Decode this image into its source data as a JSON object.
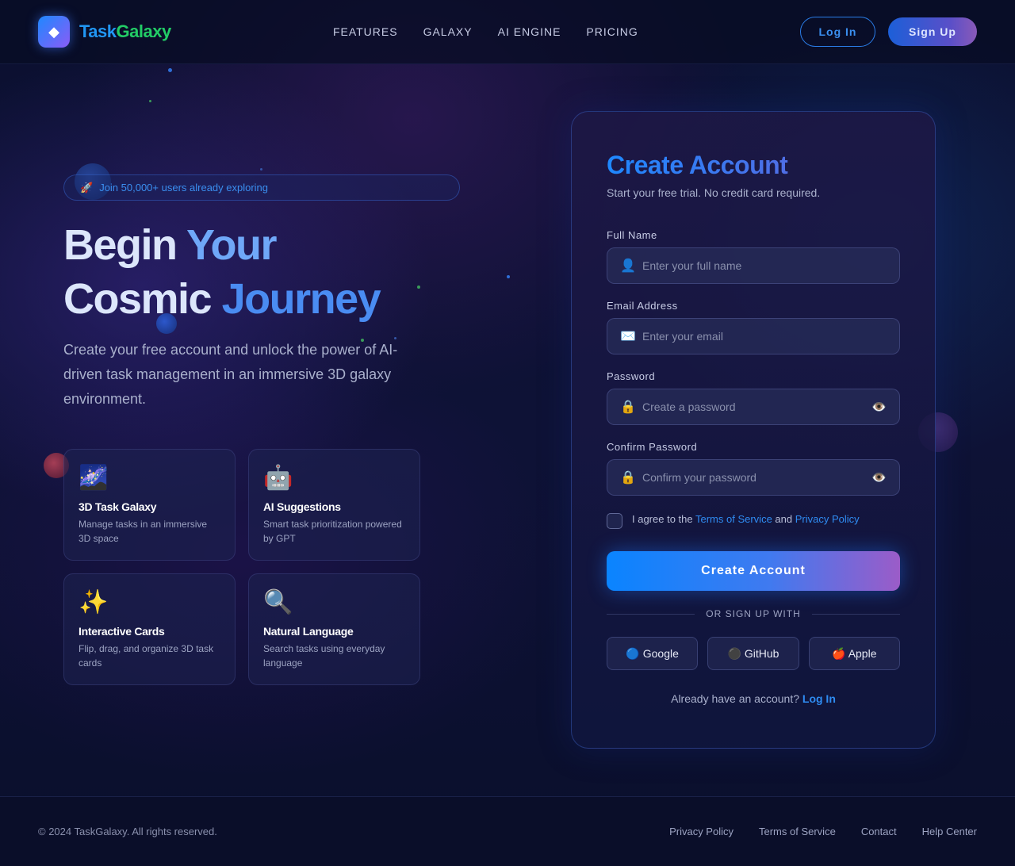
{
  "header": {
    "logo_glyph": "◆",
    "brand_part1": "Task",
    "brand_part2": "Galaxy",
    "nav": [
      "FEATURES",
      "GALAXY",
      "AI ENGINE",
      "PRICING"
    ],
    "login_label": "Log In",
    "signup_label": "Sign Up"
  },
  "hero": {
    "badge_icon": "🚀",
    "badge_text": "Join 50,000+ users already exploring",
    "title_line1_a": "Begin ",
    "title_line1_b": "Your",
    "title_line2_a": "Cosmic ",
    "title_line2_b": "Journey",
    "subtitle": "Create your free account and unlock the power of AI-driven task management in an immersive 3D galaxy environment."
  },
  "features": [
    {
      "icon": "🌌",
      "title": "3D Task Galaxy",
      "desc": "Manage tasks in an immersive 3D space"
    },
    {
      "icon": "🤖",
      "title": "AI Suggestions",
      "desc": "Smart task prioritization powered by GPT"
    },
    {
      "icon": "✨",
      "title": "Interactive Cards",
      "desc": "Flip, drag, and organize 3D task cards"
    },
    {
      "icon": "🔍",
      "title": "Natural Language",
      "desc": "Search tasks using everyday language"
    }
  ],
  "form": {
    "title": "Create Account",
    "subtitle": "Start your free trial. No credit card required.",
    "fields": {
      "full_name": {
        "label": "Full Name",
        "placeholder": "Enter your full name",
        "icon": "👤"
      },
      "email": {
        "label": "Email Address",
        "placeholder": "Enter your email",
        "icon": "✉️"
      },
      "password": {
        "label": "Password",
        "placeholder": "Create a password",
        "icon": "🔒",
        "toggle": "👁️"
      },
      "confirm": {
        "label": "Confirm Password",
        "placeholder": "Confirm your password",
        "icon": "🔒",
        "toggle": "👁️"
      }
    },
    "agree_prefix": "I agree to the ",
    "terms_link": "Terms of Service",
    "agree_mid": " and ",
    "privacy_link": "Privacy Policy",
    "submit_label": "Create Account",
    "divider_text": "OR SIGN UP WITH",
    "social": [
      {
        "icon": "🔵",
        "label": "Google"
      },
      {
        "icon": "⚫",
        "label": "GitHub"
      },
      {
        "icon": "🍎",
        "label": "Apple"
      }
    ],
    "login_prompt": "Already have an account? ",
    "login_link": "Log In"
  },
  "footer": {
    "copyright": "© 2024 TaskGalaxy. All rights reserved.",
    "links": [
      "Privacy Policy",
      "Terms of Service",
      "Contact",
      "Help Center"
    ]
  },
  "colors": {
    "accent_blue": "#0a84ff",
    "accent_purple": "#9b5cc8",
    "brand_green": "#22cc66",
    "background": "#0a0f2a"
  }
}
